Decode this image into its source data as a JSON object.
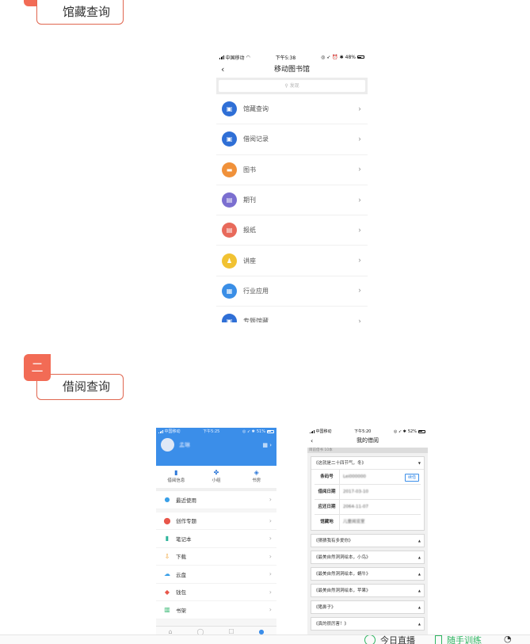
{
  "section1": {
    "title": "馆藏查询"
  },
  "section2": {
    "number": "二",
    "title": "借阅查询"
  },
  "phone1": {
    "status": {
      "carrier": "中国移动",
      "time": "下午5:38",
      "battery": "48%"
    },
    "nav": {
      "title": "移动图书馆"
    },
    "search": {
      "placeholder": "发现"
    },
    "items": [
      {
        "label": "馆藏查询",
        "color": "#2f6fd6",
        "icon": "library-icon"
      },
      {
        "label": "借阅记录",
        "color": "#2f6fd6",
        "icon": "borrow-record-icon"
      },
      {
        "label": "图书",
        "color": "#f0913a",
        "icon": "book-icon"
      },
      {
        "label": "期刊",
        "color": "#7b6fd0",
        "icon": "journal-icon"
      },
      {
        "label": "报纸",
        "color": "#e86a5b",
        "icon": "newspaper-icon"
      },
      {
        "label": "讲座",
        "color": "#f1c232",
        "icon": "lecture-icon"
      },
      {
        "label": "行业应用",
        "color": "#3a8ee6",
        "icon": "industry-app-icon"
      },
      {
        "label": "专题馆藏",
        "color": "#2f6fd6",
        "icon": "collection-icon"
      }
    ]
  },
  "phone2": {
    "status": {
      "carrier": "中国移动",
      "time": "下午5:25",
      "battery": "51%"
    },
    "user": {
      "name": "孟琳"
    },
    "tabs": [
      {
        "label": "借阅信息",
        "icon": "book-open-icon"
      },
      {
        "label": "小组",
        "icon": "group-icon"
      },
      {
        "label": "书房",
        "icon": "study-icon"
      }
    ],
    "menu": [
      {
        "label": "最近使用",
        "color": "#3aa0e8",
        "icon": "clock-icon"
      },
      {
        "label": "创作专题",
        "color": "#e8564a",
        "icon": "pin-icon"
      },
      {
        "label": "笔记本",
        "color": "#2bb39a",
        "icon": "notebook-icon"
      },
      {
        "label": "下载",
        "color": "#f0a030",
        "icon": "download-icon"
      },
      {
        "label": "云盘",
        "color": "#3aa0e8",
        "icon": "cloud-icon"
      },
      {
        "label": "钱包",
        "color": "#e8564a",
        "icon": "wallet-icon"
      },
      {
        "label": "书架",
        "color": "#2bb36a",
        "icon": "bookshelf-icon"
      }
    ]
  },
  "phone3": {
    "status": {
      "carrier": "中国移动",
      "time": "下午5:20",
      "battery": "52%"
    },
    "nav": {
      "title": "我的借阅"
    },
    "strip": "目前借书 10本",
    "first_book": {
      "title": "《这就是二十四节气，冬》",
      "fields": [
        {
          "key": "条码号",
          "value": "Lei000000",
          "renew": "续借"
        },
        {
          "key": "借阅日期",
          "value": "2017-03-10"
        },
        {
          "key": "应还日期",
          "value": "2064-11-07"
        },
        {
          "key": "馆藏地",
          "value": "儿童阅览室"
        }
      ]
    },
    "books": [
      "《猜猜我有多爱你》",
      "《最美自然洞洞绘本，小鸟》",
      "《最美自然洞洞绘本，蜗牛》",
      "《最美自然洞洞绘本，苹果》",
      "《猪鼻子》",
      "《真的很厉害！》"
    ]
  },
  "bottom_bar": {
    "live": "今日直播",
    "practice": "随手训练"
  }
}
